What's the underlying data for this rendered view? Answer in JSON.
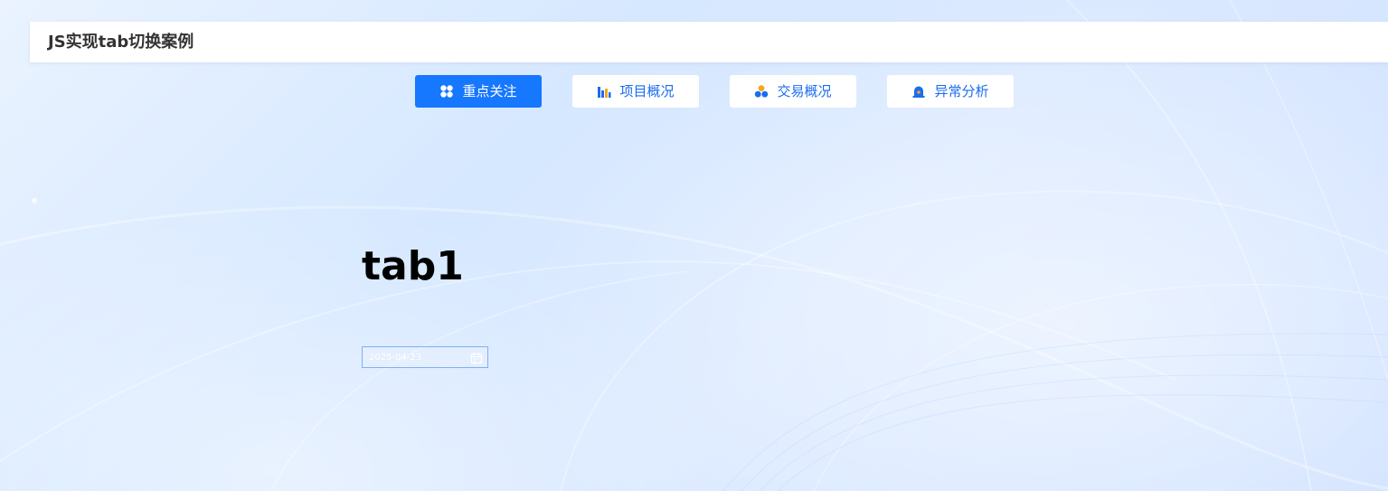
{
  "header": {
    "title": "JS实现tab切换案例"
  },
  "tabs": [
    {
      "label": "重点关注",
      "icon": "grid-icon",
      "active": true
    },
    {
      "label": "项目概况",
      "icon": "bar-chart-icon",
      "active": false
    },
    {
      "label": "交易概况",
      "icon": "circles-icon",
      "active": false
    },
    {
      "label": "异常分析",
      "icon": "alarm-icon",
      "active": false
    }
  ],
  "panel": {
    "title": "tab1",
    "date_value": "2025-04-23",
    "date_icon": "calendar-icon"
  },
  "colors": {
    "accent": "#1677ff",
    "tab_text": "#1a6cf0",
    "icon_orange": "#f5a623"
  }
}
